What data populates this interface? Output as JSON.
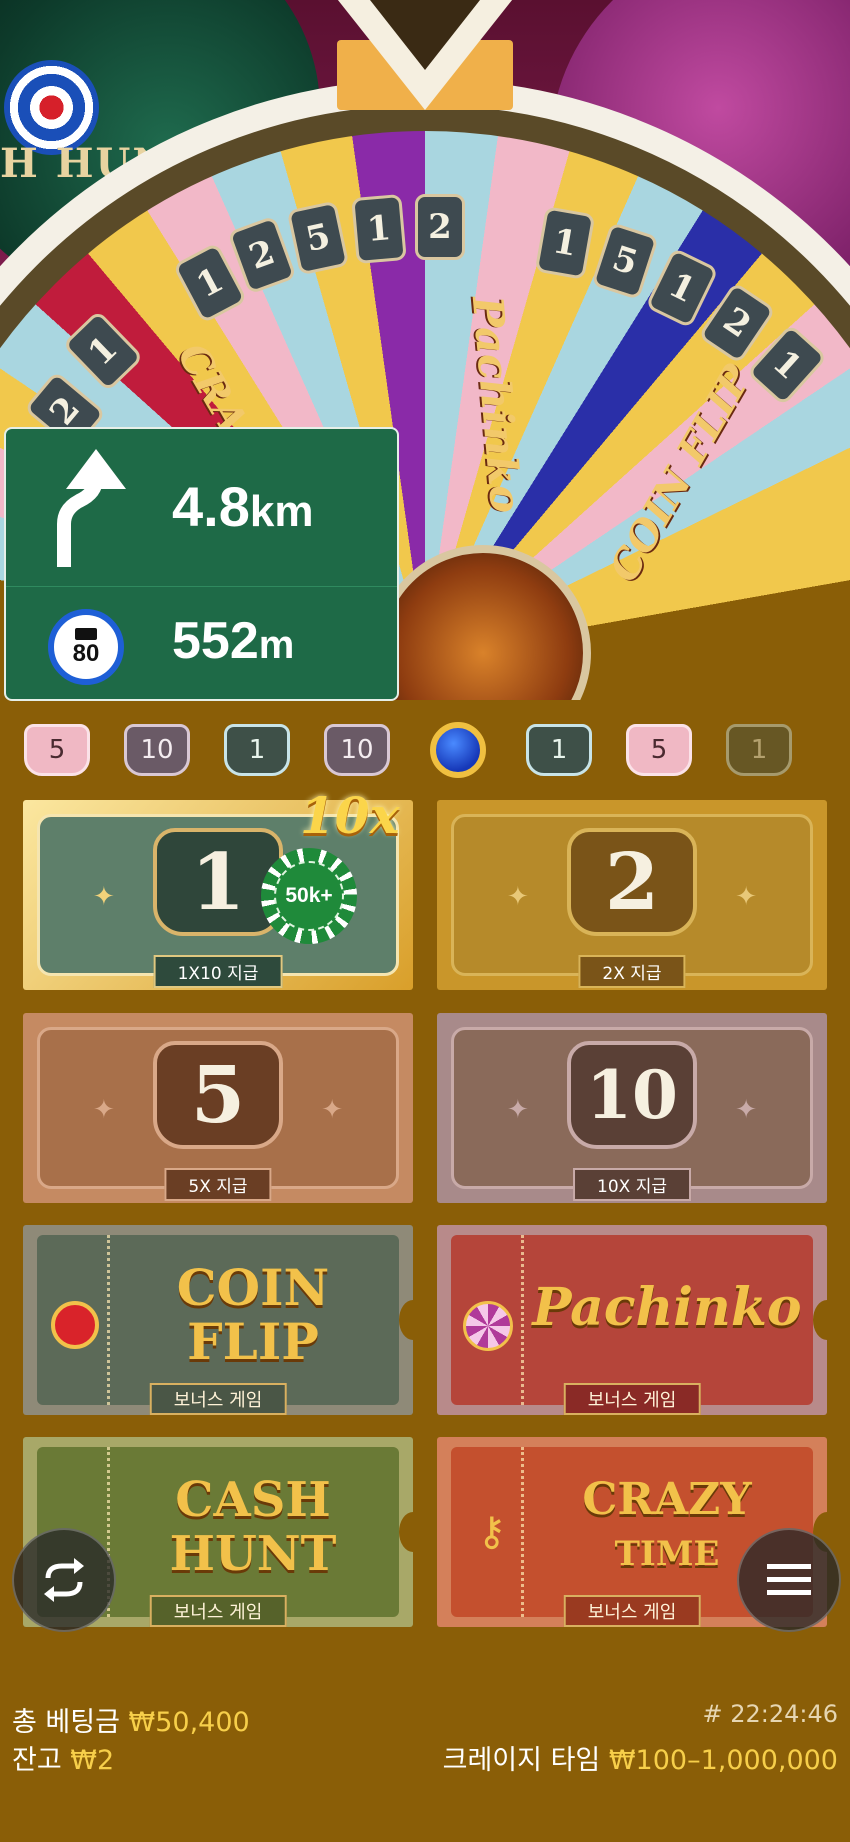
{
  "wheel": {
    "segments": [
      "2",
      "1",
      "1",
      "2",
      "5",
      "1",
      "2",
      "1",
      "5",
      "1",
      "2",
      "1"
    ],
    "labels": [
      "CRAZY",
      "Pachinko",
      "COIN FLIP"
    ],
    "deco_text": "H HUN"
  },
  "navigation": {
    "turn_distance_value": "4.8",
    "turn_distance_unit": "km",
    "speed_limit": "80",
    "camera_distance_value": "552",
    "camera_distance_unit": "m"
  },
  "history": [
    {
      "type": "c5",
      "label": "5"
    },
    {
      "type": "c10",
      "label": "10"
    },
    {
      "type": "c1",
      "label": "1"
    },
    {
      "type": "c10",
      "label": "10"
    },
    {
      "type": "bonus",
      "label": ""
    },
    {
      "type": "c1",
      "label": "1"
    },
    {
      "type": "c5",
      "label": "5"
    },
    {
      "type": "c1",
      "label": "1"
    }
  ],
  "bets": {
    "one": {
      "number": "1",
      "payout": "1X10 지급",
      "chip": "50k+",
      "multiplier": "10x"
    },
    "two": {
      "number": "2",
      "payout": "2X 지급"
    },
    "five": {
      "number": "5",
      "payout": "5X 지급"
    },
    "ten": {
      "number": "10",
      "payout": "10X 지급"
    }
  },
  "bonus_games": {
    "coin_flip": {
      "title_line1": "COIN",
      "title_line2": "FLIP",
      "label": "보너스 게임"
    },
    "pachinko": {
      "title": "Pachinko",
      "label": "보너스 게임"
    },
    "cash_hunt": {
      "title_line1": "CASH",
      "title_line2": "HUNT",
      "label": "보너스 게임"
    },
    "crazy_time": {
      "title_line1": "CRAZY",
      "title_line2": "TIME",
      "label": "보너스 게임"
    }
  },
  "footer": {
    "total_bet_label": "총 베팅금",
    "total_bet_value": "₩50,400",
    "balance_label": "잔고",
    "balance_value": "₩2",
    "round_id": "# 22:24:46",
    "game_name": "크레이지 타임",
    "limits": "₩100–1,000,000"
  },
  "colors": {
    "background": "#8a5e07",
    "accent_gold": "#f7cf4a",
    "nav_green": "#1e6a47"
  }
}
